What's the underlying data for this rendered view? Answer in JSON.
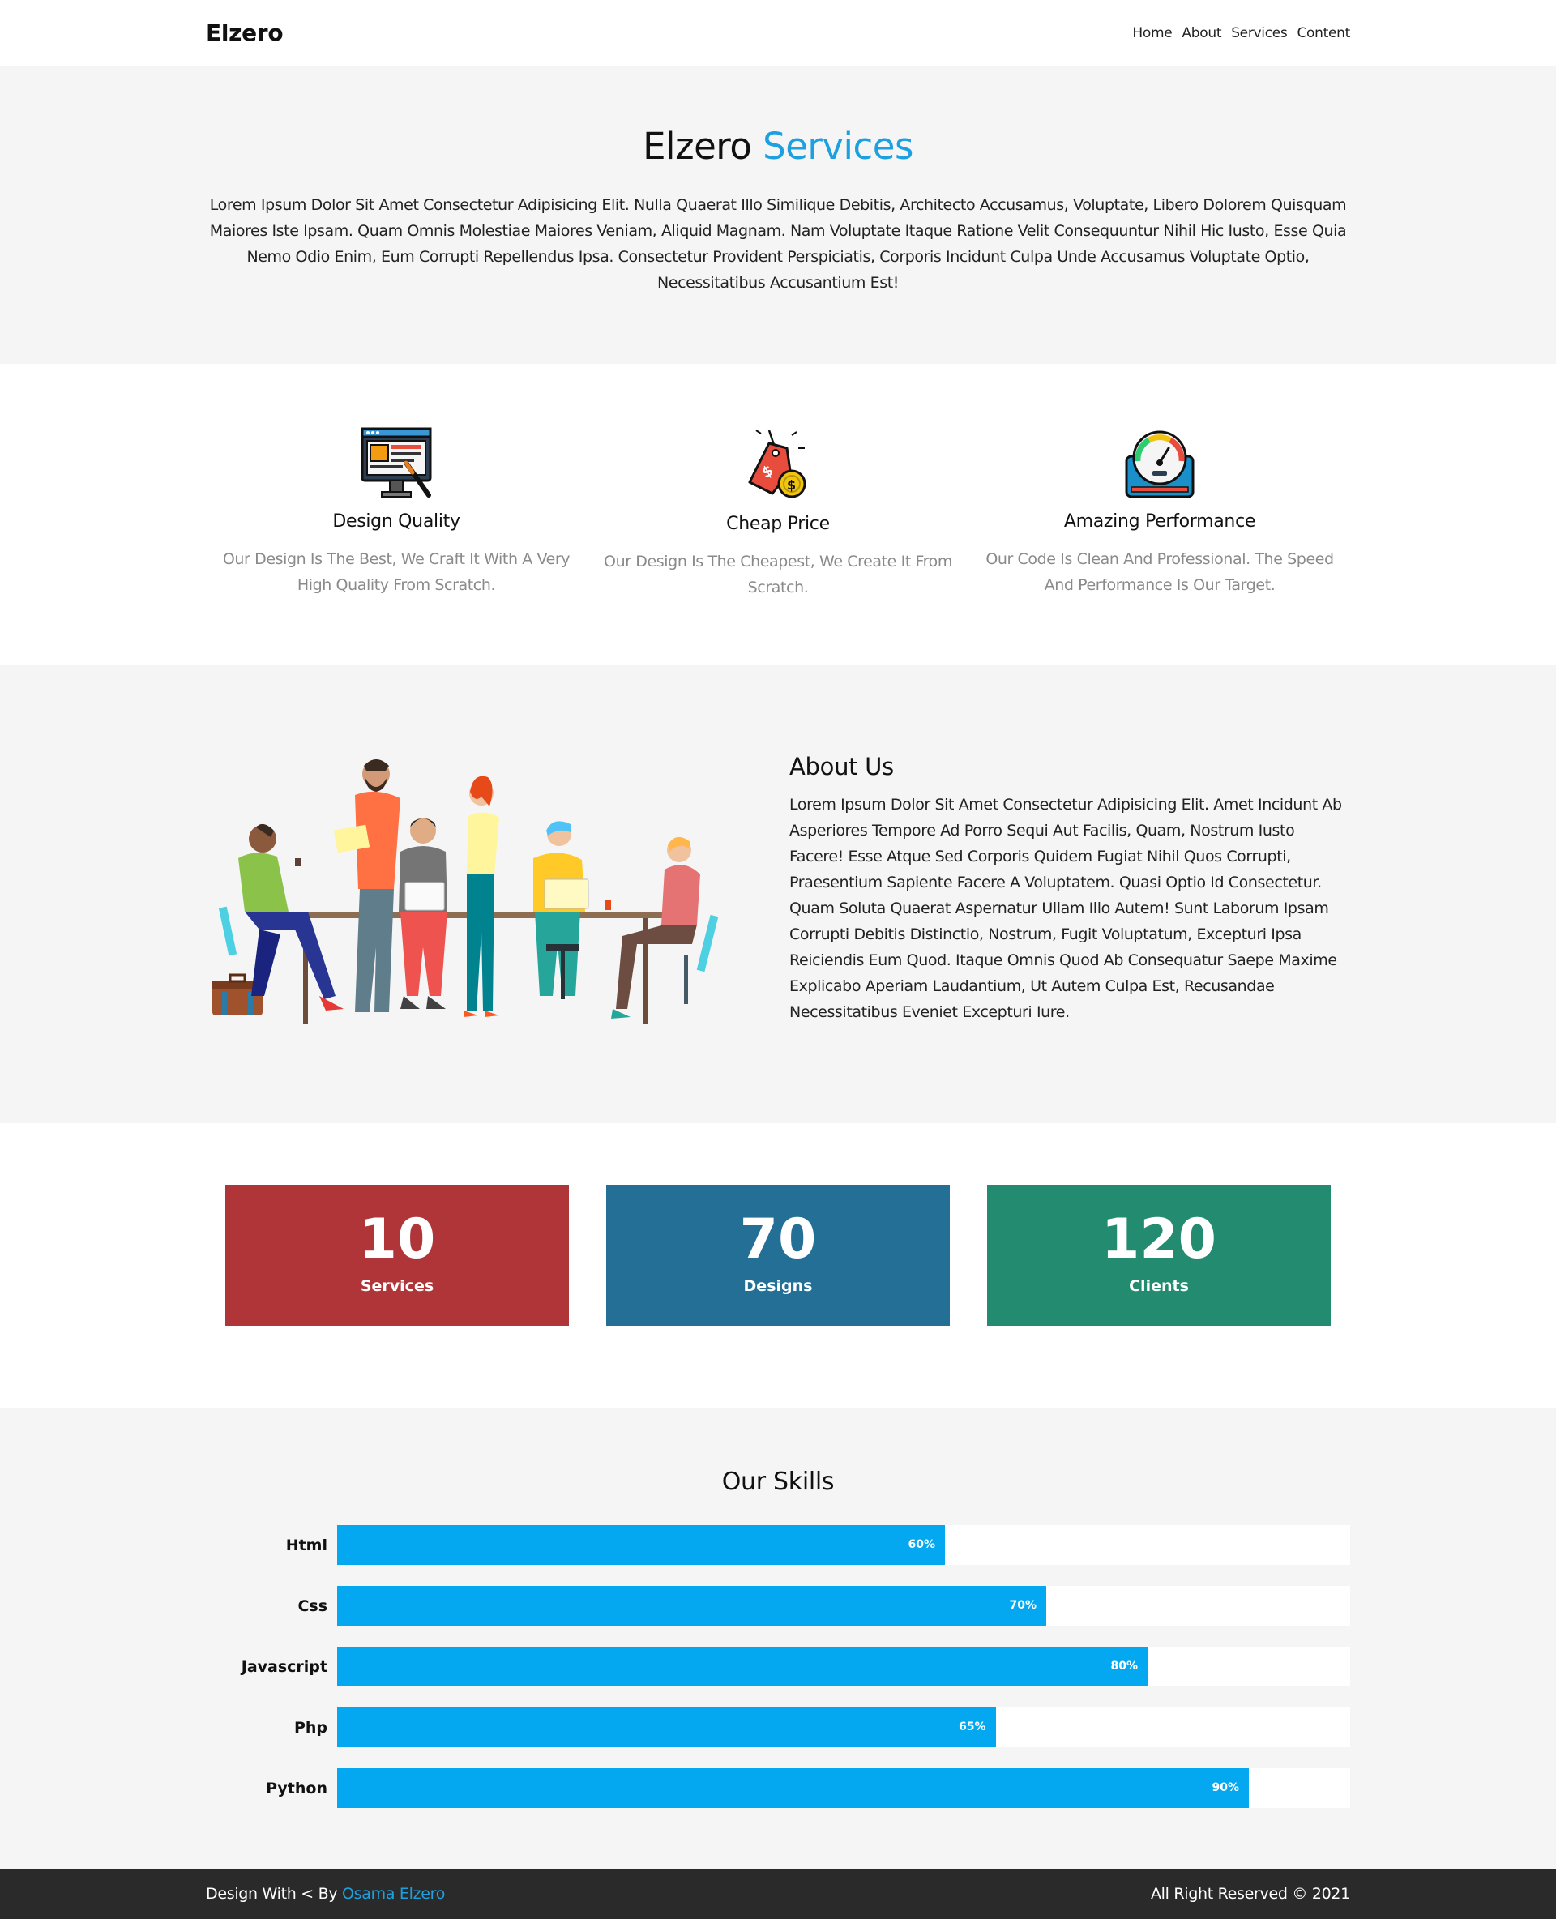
{
  "header": {
    "logo": "Elzero",
    "nav": [
      "Home",
      "About",
      "Services",
      "Content"
    ]
  },
  "intro": {
    "title_main": "Elzero",
    "title_accent": "Services",
    "paragraph": "Lorem Ipsum Dolor Sit Amet Consectetur Adipisicing Elit. Nulla Quaerat Illo Similique Debitis, Architecto Accusamus, Voluptate, Libero Dolorem Quisquam Maiores Iste Ipsam. Quam Omnis Molestiae Maiores Veniam, Aliquid Magnam. Nam Voluptate Itaque Ratione Velit Consequuntur Nihil Hic Iusto, Esse Quia Nemo Odio Enim, Eum Corrupti Repellendus Ipsa. Consectetur Provident Perspiciatis, Corporis Incidunt Culpa Unde Accusamus Voluptate Optio, Necessitatibus Accusantium Est!",
    "accent_color": "#1da0e0"
  },
  "services": [
    {
      "icon": "design-monitor-icon",
      "title": "Design Quality",
      "text": "Our Design Is The Best, We Craft It With A Very High Quality From Scratch."
    },
    {
      "icon": "price-tag-icon",
      "title": "Cheap Price",
      "text": "Our Design Is The Cheapest, We Create It From Scratch."
    },
    {
      "icon": "speedometer-icon",
      "title": "Amazing Performance",
      "text": "Our Code Is Clean And Professional. The Speed And Performance Is Our Target."
    }
  ],
  "about": {
    "title": "About Us",
    "paragraph": "Lorem Ipsum Dolor Sit Amet Consectetur Adipisicing Elit. Amet Incidunt Ab Asperiores Tempore Ad Porro Sequi Aut Facilis, Quam, Nostrum Iusto Facere! Esse Atque Sed Corporis Quidem Fugiat Nihil Quos Corrupti, Praesentium Sapiente Facere A Voluptatem. Quasi Optio Id Consectetur. Quam Soluta Quaerat Aspernatur Ullam Illo Autem! Sunt Laborum Ipsam Corrupti Debitis Distinctio, Nostrum, Fugit Voluptatum, Excepturi Ipsa Reiciendis Eum Quod. Itaque Omnis Quod Ab Consequatur Saepe Maxime Explicabo Aperiam Laudantium, Ut Autem Culpa Est, Recusandae Necessitatibus Eveniet Excepturi Iure.",
    "image": "team-illustration"
  },
  "stats": [
    {
      "number": "10",
      "label": "Services",
      "color": "#b03538"
    },
    {
      "number": "70",
      "label": "Designs",
      "color": "#236f96"
    },
    {
      "number": "120",
      "label": "Clients",
      "color": "#238b70"
    }
  ],
  "skills": {
    "title": "Our Skills",
    "bar_color": "#03a8f0",
    "items": [
      {
        "name": "Html",
        "percent_label": "60%",
        "percent": 60
      },
      {
        "name": "Css",
        "percent_label": "70%",
        "percent": 70
      },
      {
        "name": "Javascript",
        "percent_label": "80%",
        "percent": 80
      },
      {
        "name": "Php",
        "percent_label": "65%",
        "percent": 65
      },
      {
        "name": "Python",
        "percent_label": "90%",
        "percent": 90
      }
    ]
  },
  "footer": {
    "left_prefix": "Design With < By",
    "author": "Osama Elzero",
    "right": "All Right Reserved © 2021"
  }
}
